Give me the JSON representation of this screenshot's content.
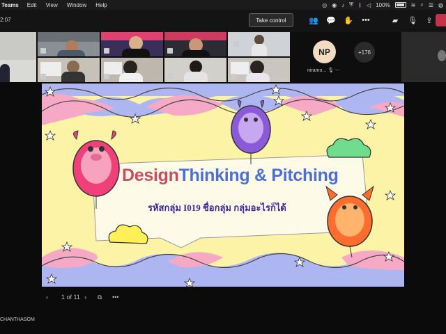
{
  "menubar": {
    "app": "Teams",
    "items": [
      "Edit",
      "View",
      "Window",
      "Help"
    ],
    "battery": "100%"
  },
  "toolbar": {
    "timer": "2:07",
    "take_control": "Take control"
  },
  "participants": {
    "avatar_initials": "NP",
    "avatar_name": "niramo...",
    "more_count": "+176"
  },
  "slide": {
    "title_part1": "Design",
    "title_part2": "Thinking & Pitching",
    "subtitle": "รหัสกลุ่ม I019  ชื่อกลุ่ม กลุ่มอะไรก็ได้"
  },
  "pager": {
    "page": "1 of 11"
  },
  "footer": {
    "presenter_name": "CHANTHASOM"
  },
  "colors": {
    "leave": "#c4314b",
    "title1": "#c94c66",
    "title2": "#4b6fd6",
    "slide_bg": "#fdf3a6"
  }
}
